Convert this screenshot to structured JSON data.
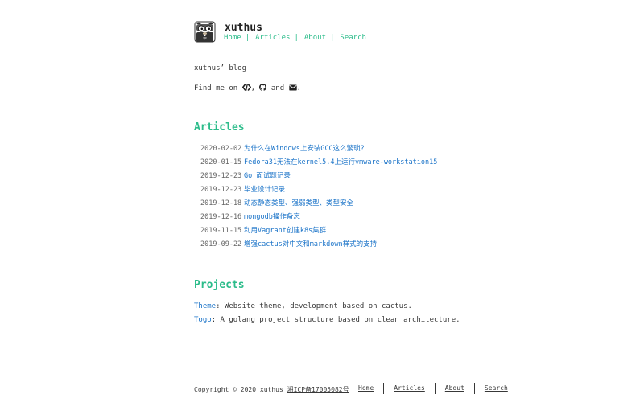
{
  "header": {
    "site_title": "xuthus",
    "nav": [
      {
        "label": "Home"
      },
      {
        "label": "Articles"
      },
      {
        "label": "About"
      },
      {
        "label": "Search"
      }
    ]
  },
  "intro": {
    "tagline": "xuthus’ blog",
    "find_me_prefix": "Find me on ",
    "find_me_sep1": ", ",
    "find_me_and": " and ",
    "find_me_end": ".",
    "icons": [
      "code-icon",
      "github-icon",
      "envelope-icon"
    ]
  },
  "articles": {
    "heading": "Articles",
    "posts": [
      {
        "date": "2020-02-02",
        "title": "为什么在Windows上安装GCC这么繁琐?"
      },
      {
        "date": "2020-01-15",
        "title": "Fedora31无法在kernel5.4上运行vmware-workstation15"
      },
      {
        "date": "2019-12-23",
        "title": "Go 面试题记录"
      },
      {
        "date": "2019-12-23",
        "title": "毕业设计记录"
      },
      {
        "date": "2019-12-18",
        "title": "动态静态类型、强弱类型、类型安全"
      },
      {
        "date": "2019-12-16",
        "title": "mongodb操作备忘"
      },
      {
        "date": "2019-11-15",
        "title": "利用Vagrant创建k8s集群"
      },
      {
        "date": "2019-09-22",
        "title": "增强cactus对中文和markdown样式的支持"
      }
    ]
  },
  "projects": {
    "heading": "Projects",
    "items": [
      {
        "name": "Theme",
        "description": ": Website theme, development based on cactus."
      },
      {
        "name": "Togo",
        "description": ": A golang project structure based on clean architecture."
      }
    ]
  },
  "footer": {
    "copyright": "Copyright © 2020 xuthus ",
    "icp": "湘ICP备17005082号",
    "nav": [
      {
        "label": "Home"
      },
      {
        "label": "Articles"
      },
      {
        "label": "About"
      },
      {
        "label": "Search"
      }
    ]
  },
  "colors": {
    "accent": "#2bbc8a",
    "link": "#1a73c8",
    "text": "#383838"
  }
}
